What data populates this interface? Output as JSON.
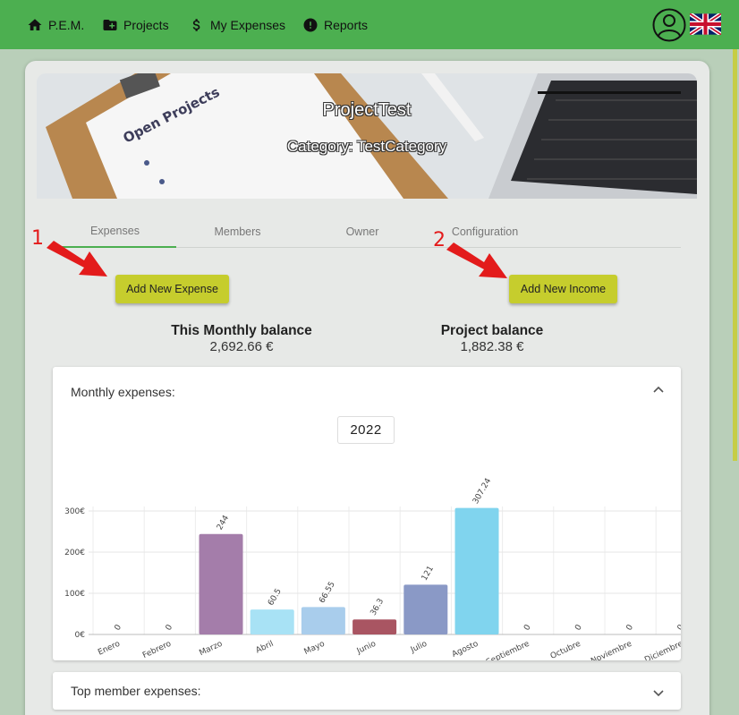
{
  "nav": {
    "items": [
      {
        "label": "P.E.M.",
        "icon": "home-icon"
      },
      {
        "label": "Projects",
        "icon": "folder-add-icon"
      },
      {
        "label": "My Expenses",
        "icon": "dollar-icon"
      },
      {
        "label": "Reports",
        "icon": "alert-circle-icon"
      }
    ],
    "profile_icon": "account-circle-icon",
    "language_icon": "uk-flag-icon"
  },
  "project": {
    "name": "ProjectTest",
    "category": "Category: TestCategory",
    "banner_texts": {
      "clipboard": "Open Projects"
    }
  },
  "tabs": [
    {
      "label": "Expenses",
      "active": true
    },
    {
      "label": "Members",
      "active": false
    },
    {
      "label": "Owner",
      "active": false
    },
    {
      "label": "Configuration",
      "active": false
    }
  ],
  "annotations": [
    "1",
    "2"
  ],
  "actions": {
    "add_expense": "Add New Expense",
    "add_income": "Add New Income"
  },
  "balances": {
    "monthly_title": "This Monthly balance",
    "monthly_value": "2,692.66 €",
    "project_title": "Project balance",
    "project_value": "1,882.38 €"
  },
  "monthly_panel": {
    "title": "Monthly expenses:",
    "year": "2022"
  },
  "top_members_panel": {
    "title": "Top member expenses:"
  },
  "chart_data": {
    "type": "bar",
    "categories": [
      "Enero",
      "Febrero",
      "Marzo",
      "Abril",
      "Mayo",
      "Junio",
      "Julio",
      "Agosto",
      "Septiembre",
      "Octubre",
      "Noviembre",
      "Diciembre"
    ],
    "values": [
      0,
      0,
      244,
      60.5,
      66.55,
      36.3,
      121,
      307.24,
      0,
      0,
      0,
      0
    ],
    "value_labels": [
      "0",
      "0",
      "244",
      "60.5",
      "66.55",
      "36.3",
      "121",
      "307.24",
      "0",
      "0",
      "0",
      "0"
    ],
    "colors": [
      "#9e9e9e",
      "#9e9e9e",
      "#a47daa",
      "#a8e2f5",
      "#a9cdec",
      "#a95562",
      "#8a99c6",
      "#80d4ee",
      "#9e9e9e",
      "#9e9e9e",
      "#9e9e9e",
      "#9e9e9e"
    ],
    "y_ticks": [
      "0€",
      "100€",
      "200€",
      "300€"
    ],
    "ylim": [
      0,
      300
    ],
    "grid": true,
    "title": "",
    "xlabel": "",
    "ylabel": ""
  }
}
